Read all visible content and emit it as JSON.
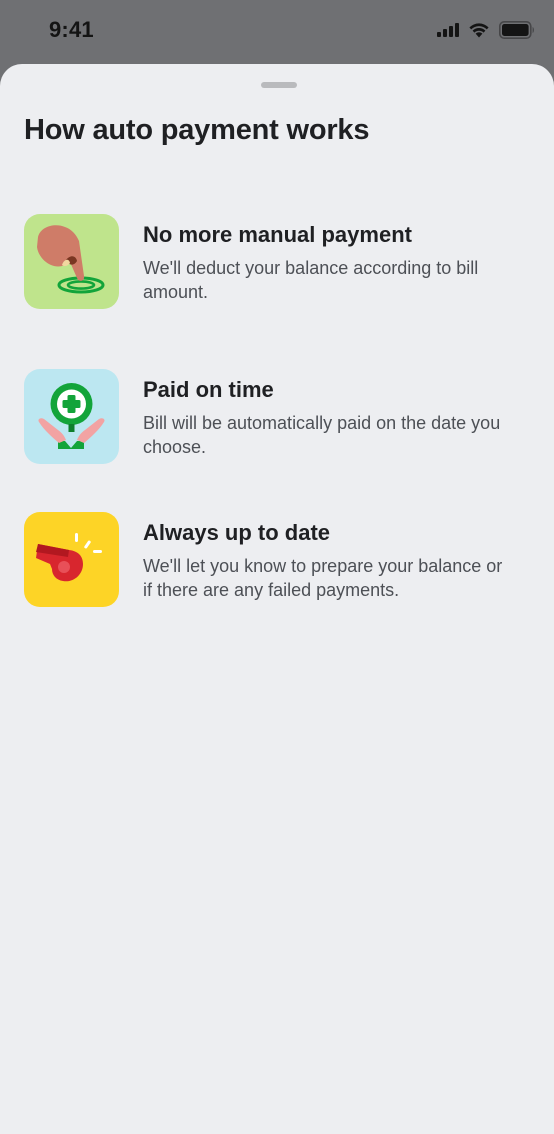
{
  "status_bar": {
    "time": "9:41",
    "icons": [
      "cellular-signal-icon",
      "wifi-icon",
      "battery-icon"
    ]
  },
  "sheet": {
    "title": "How auto payment works",
    "features": [
      {
        "icon": "hand-tap-icon",
        "icon_bg": "#bfe48c",
        "title": "No more manual payment",
        "description": "We'll deduct your balance according to bill amount."
      },
      {
        "icon": "hands-health-plus-icon",
        "icon_bg": "#bce7f1",
        "title": "Paid on time",
        "description": "Bill will be automatically paid on the date you choose."
      },
      {
        "icon": "whistle-icon",
        "icon_bg": "#fdd426",
        "title": "Always up to date",
        "description": "We'll let you know to prepare your balance or if there are any failed payments."
      }
    ]
  },
  "colors": {
    "backdrop": "#6f7073",
    "sheet_background": "#edeef1",
    "title_text": "#1f2023",
    "body_text": "#4d5056",
    "accent_green": "#12a43a",
    "whistle_red": "#d8262e"
  }
}
